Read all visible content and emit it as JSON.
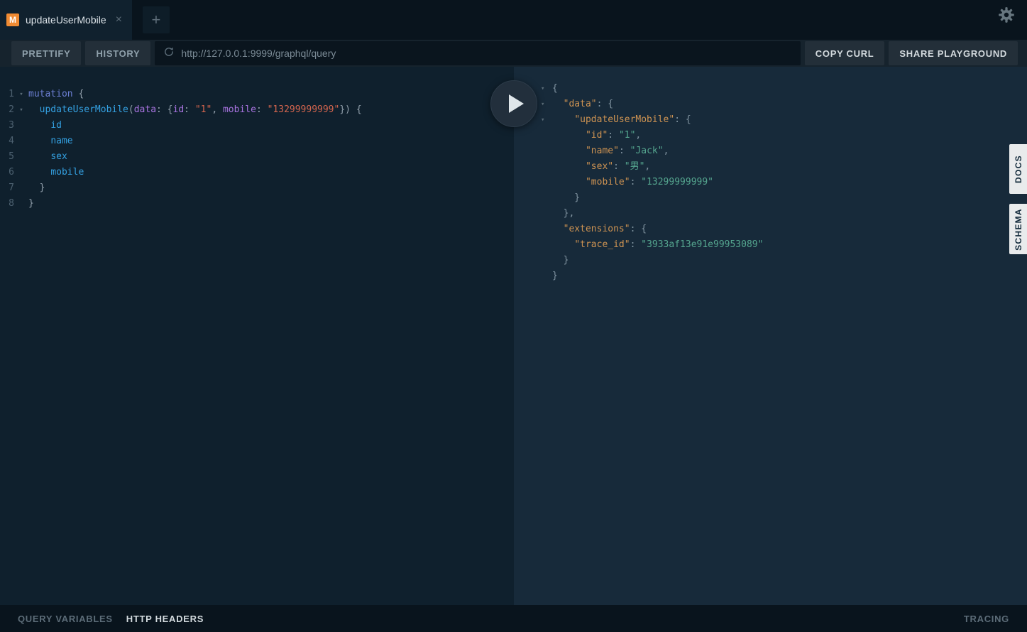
{
  "tabbar": {
    "tab_badge": "M",
    "tab_title": "updateUserMobile",
    "close_symbol": "×",
    "new_tab_symbol": "+"
  },
  "toolbar": {
    "prettify": "PRETTIFY",
    "history": "HISTORY",
    "url": "http://127.0.0.1:9999/graphql/query",
    "copy_curl": "COPY CURL",
    "share_playground": "SHARE PLAYGROUND"
  },
  "editor": {
    "lines": [
      {
        "num": "1",
        "fold": true,
        "tokens": [
          [
            "kw",
            "mutation"
          ],
          [
            "pn",
            " {"
          ]
        ]
      },
      {
        "num": "2",
        "fold": true,
        "tokens": [
          [
            "pn",
            "  "
          ],
          [
            "fd",
            "updateUserMobile"
          ],
          [
            "pn",
            "("
          ],
          [
            "arg",
            "data"
          ],
          [
            "pn",
            ": {"
          ],
          [
            "arg",
            "id"
          ],
          [
            "pn",
            ": "
          ],
          [
            "str",
            "\"1\""
          ],
          [
            "pn",
            ", "
          ],
          [
            "arg",
            "mobile"
          ],
          [
            "pn",
            ": "
          ],
          [
            "str",
            "\"13299999999\""
          ],
          [
            "pn",
            "}) {"
          ]
        ]
      },
      {
        "num": "3",
        "fold": false,
        "tokens": [
          [
            "pn",
            "    "
          ],
          [
            "fd",
            "id"
          ]
        ]
      },
      {
        "num": "4",
        "fold": false,
        "tokens": [
          [
            "pn",
            "    "
          ],
          [
            "fd",
            "name"
          ]
        ]
      },
      {
        "num": "5",
        "fold": false,
        "tokens": [
          [
            "pn",
            "    "
          ],
          [
            "fd",
            "sex"
          ]
        ]
      },
      {
        "num": "6",
        "fold": false,
        "tokens": [
          [
            "pn",
            "    "
          ],
          [
            "fd",
            "mobile"
          ]
        ]
      },
      {
        "num": "7",
        "fold": false,
        "tokens": [
          [
            "pn",
            "  }"
          ]
        ]
      },
      {
        "num": "8",
        "fold": false,
        "tokens": [
          [
            "pn",
            "}"
          ]
        ]
      }
    ]
  },
  "result": {
    "lines": [
      {
        "fold": true,
        "tokens": [
          [
            "pn",
            "{"
          ]
        ]
      },
      {
        "fold": true,
        "tokens": [
          [
            "pn",
            "  "
          ],
          [
            "key",
            "\"data\""
          ],
          [
            "pn",
            ": {"
          ]
        ]
      },
      {
        "fold": true,
        "tokens": [
          [
            "pn",
            "    "
          ],
          [
            "key",
            "\"updateUserMobile\""
          ],
          [
            "pn",
            ": {"
          ]
        ]
      },
      {
        "fold": false,
        "tokens": [
          [
            "pn",
            "      "
          ],
          [
            "key",
            "\"id\""
          ],
          [
            "pn",
            ": "
          ],
          [
            "val",
            "\"1\""
          ],
          [
            "pn",
            ","
          ]
        ]
      },
      {
        "fold": false,
        "tokens": [
          [
            "pn",
            "      "
          ],
          [
            "key",
            "\"name\""
          ],
          [
            "pn",
            ": "
          ],
          [
            "val",
            "\"Jack\""
          ],
          [
            "pn",
            ","
          ]
        ]
      },
      {
        "fold": false,
        "tokens": [
          [
            "pn",
            "      "
          ],
          [
            "key",
            "\"sex\""
          ],
          [
            "pn",
            ": "
          ],
          [
            "val",
            "\"男\""
          ],
          [
            "pn",
            ","
          ]
        ]
      },
      {
        "fold": false,
        "tokens": [
          [
            "pn",
            "      "
          ],
          [
            "key",
            "\"mobile\""
          ],
          [
            "pn",
            ": "
          ],
          [
            "val",
            "\"13299999999\""
          ]
        ]
      },
      {
        "fold": false,
        "tokens": [
          [
            "pn",
            "    }"
          ]
        ]
      },
      {
        "fold": false,
        "tokens": [
          [
            "pn",
            "  },"
          ]
        ]
      },
      {
        "fold": false,
        "tokens": [
          [
            "pn",
            "  "
          ],
          [
            "key",
            "\"extensions\""
          ],
          [
            "pn",
            ": {"
          ]
        ]
      },
      {
        "fold": false,
        "tokens": [
          [
            "pn",
            "    "
          ],
          [
            "key",
            "\"trace_id\""
          ],
          [
            "pn",
            ": "
          ],
          [
            "val",
            "\"3933af13e91e99953089\""
          ]
        ]
      },
      {
        "fold": false,
        "tokens": [
          [
            "pn",
            "  }"
          ]
        ]
      },
      {
        "fold": false,
        "tokens": [
          [
            "pn",
            "}"
          ]
        ]
      }
    ]
  },
  "side_tabs": {
    "docs": "DOCS",
    "schema": "SCHEMA"
  },
  "bottombar": {
    "query_variables": "QUERY VARIABLES",
    "http_headers": "HTTP HEADERS",
    "tracing": "TRACING"
  },
  "colors": {
    "tab_badge_bg": "#f08b33",
    "keyword": "#6c7fd3",
    "field": "#34a1e2",
    "argument": "#a873e0",
    "string": "#d4654e",
    "result_key": "#ce9352",
    "result_value": "#55a68f",
    "docs_tab_bg": "#e9ebec"
  }
}
